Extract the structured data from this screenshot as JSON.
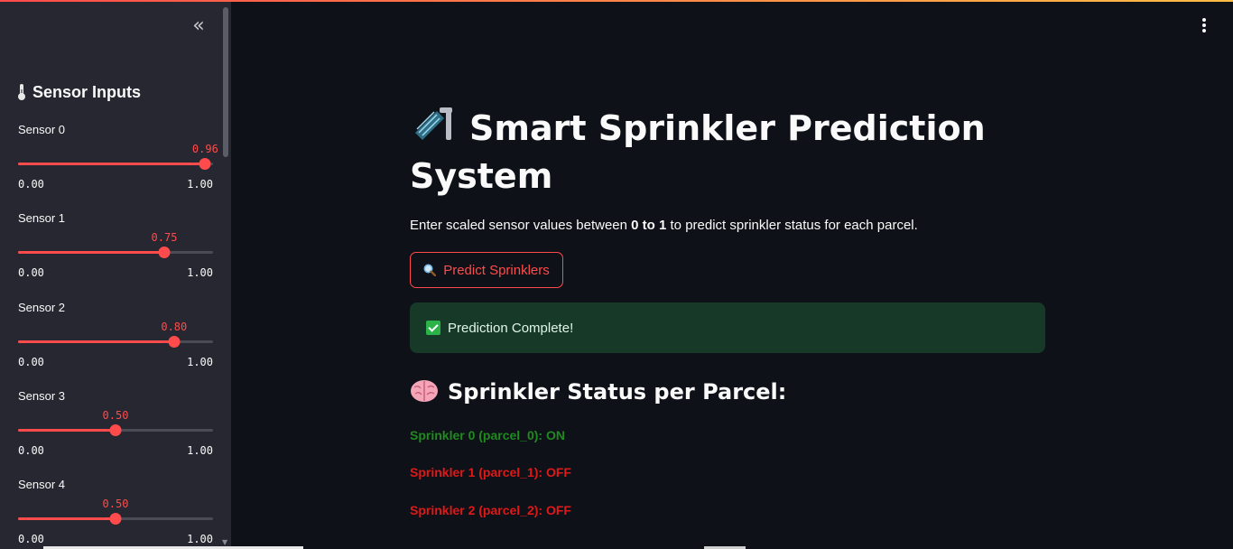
{
  "sidebar": {
    "title": "Sensor Inputs",
    "collapse_icon": "chevrons-left-icon",
    "sliders": [
      {
        "label": "Sensor 0",
        "value": "0.96",
        "min": "0.00",
        "max": "1.00",
        "fraction": 0.96
      },
      {
        "label": "Sensor 1",
        "value": "0.75",
        "min": "0.00",
        "max": "1.00",
        "fraction": 0.75
      },
      {
        "label": "Sensor 2",
        "value": "0.80",
        "min": "0.00",
        "max": "1.00",
        "fraction": 0.8
      },
      {
        "label": "Sensor 3",
        "value": "0.50",
        "min": "0.00",
        "max": "1.00",
        "fraction": 0.5
      },
      {
        "label": "Sensor 4",
        "value": "0.50",
        "min": "0.00",
        "max": "1.00",
        "fraction": 0.5
      }
    ]
  },
  "header": {
    "menu_icon": "kebab-menu-icon"
  },
  "main": {
    "title": "Smart Sprinkler Prediction System",
    "description_pre": "Enter scaled sensor values between ",
    "description_bold": "0 to 1",
    "description_post": " to predict sprinkler status for each parcel.",
    "predict_button": "Predict Sprinklers",
    "success_message": "Prediction Complete!",
    "section_title": "Sprinkler Status per Parcel:",
    "statuses": [
      {
        "text": "Sprinkler 0 (parcel_0): ON",
        "color": "#1f8a1f"
      },
      {
        "text": "Sprinkler 1 (parcel_1): OFF",
        "color": "#e01818"
      },
      {
        "text": "Sprinkler 2 (parcel_2): OFF",
        "color": "#e01818"
      }
    ]
  },
  "colors": {
    "accent": "#ff4b4b",
    "sidebar_bg": "#262730",
    "main_bg": "#0e1117",
    "success_bg": "#173928"
  }
}
